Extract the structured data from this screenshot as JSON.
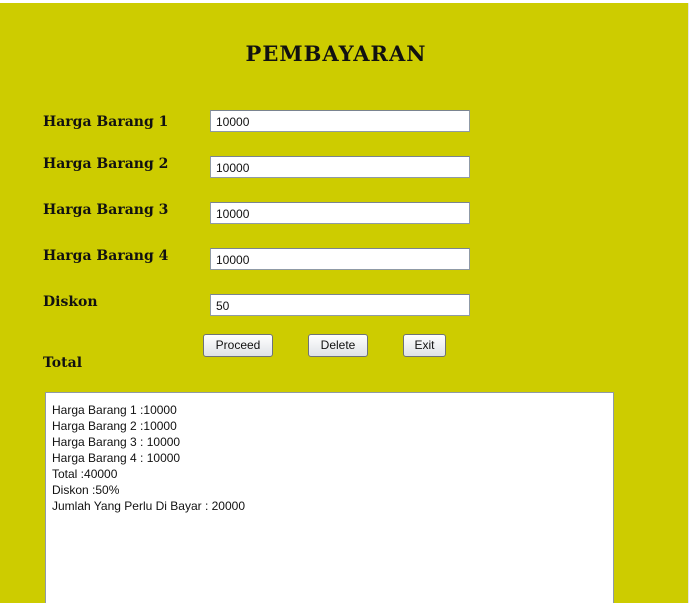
{
  "title": "PEMBAYARAN",
  "labels": {
    "harga1": "Harga Barang 1",
    "harga2": "Harga Barang 2",
    "harga3": "Harga Barang 3",
    "harga4": "Harga Barang 4",
    "diskon": "Diskon",
    "total": "Total"
  },
  "fields": {
    "harga1": "10000",
    "harga2": "10000",
    "harga3": "10000",
    "harga4": "10000",
    "diskon": "50"
  },
  "buttons": {
    "proceed": "Proceed",
    "delete": "Delete",
    "exit": "Exit"
  },
  "output_lines": [
    "Harga Barang 1 :10000",
    "Harga Barang 2 :10000",
    "Harga Barang 3 : 10000",
    "Harga Barang 4 : 10000",
    "Total :40000",
    "Diskon :50%",
    "Jumlah Yang Perlu Di Bayar : 20000"
  ],
  "colors": {
    "panel_background": "#cdcc00"
  }
}
